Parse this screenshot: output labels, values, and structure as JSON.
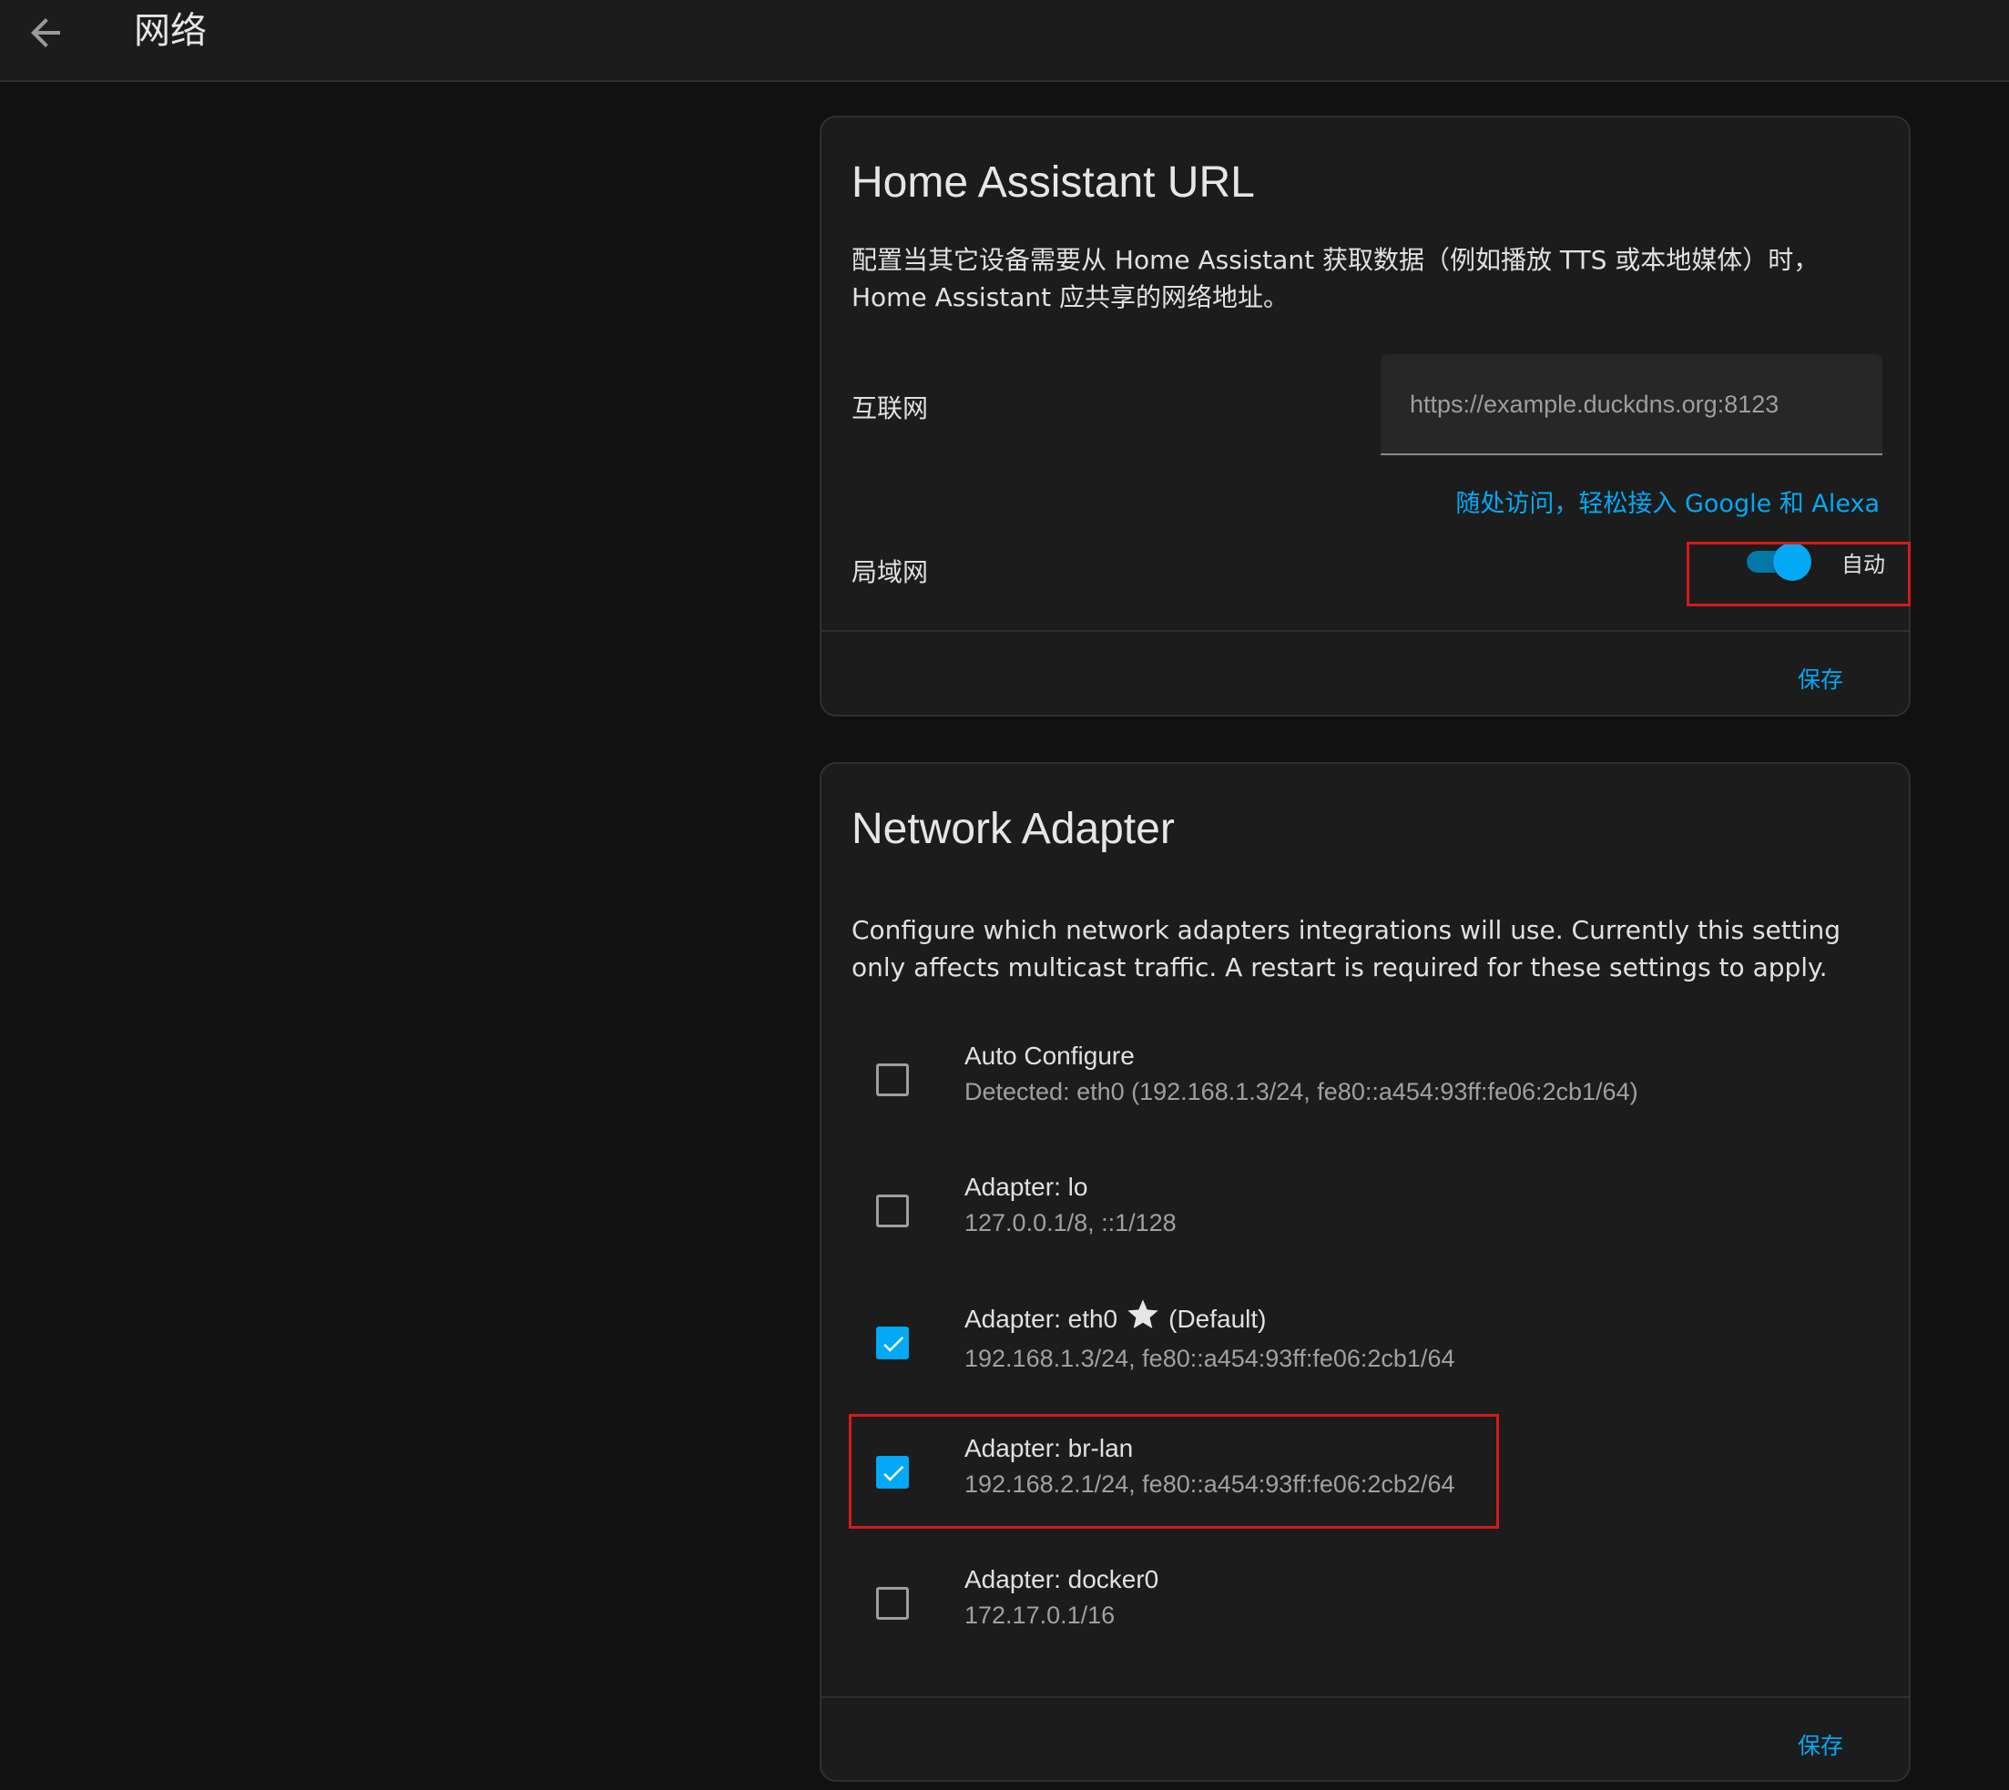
{
  "header": {
    "title": "网络"
  },
  "url_card": {
    "title": "Home Assistant URL",
    "description": "配置当其它设备需要从 Home Assistant 获取数据（例如播放 TTS 或本地媒体）时，Home Assistant 应共享的网络地址。",
    "internet_label": "互联网",
    "internet_value": "",
    "internet_placeholder": "https://example.duckdns.org:8123",
    "promo_link": "随处访问，轻松接入 Google 和 Alexa",
    "lan_label": "局域网",
    "lan_toggle_label": "自动",
    "lan_toggle_on": true,
    "save_label": "保存"
  },
  "adapter_card": {
    "title": "Network Adapter",
    "description": "Configure which network adapters integrations will use. Currently this setting only affects multicast traffic. A restart is required for these settings to apply.",
    "adapters": [
      {
        "name": "Auto Configure",
        "detail": "Detected: eth0 (192.168.1.3/24, fe80::a454:93ff:fe06:2cb1/64)",
        "checked": false
      },
      {
        "name": "Adapter: lo",
        "detail": "127.0.0.1/8, ::1/128",
        "checked": false
      },
      {
        "name": "Adapter: eth0",
        "suffix": "(Default)",
        "detail": "192.168.1.3/24, fe80::a454:93ff:fe06:2cb1/64",
        "checked": true
      },
      {
        "name": "Adapter: br-lan",
        "detail": "192.168.2.1/24, fe80::a454:93ff:fe06:2cb2/64",
        "checked": true
      },
      {
        "name": "Adapter: docker0",
        "detail": "172.17.0.1/16",
        "checked": false
      }
    ],
    "save_label": "保存"
  },
  "colors": {
    "accent": "#03a9f4",
    "highlight": "#d61a1a",
    "background": "#111111",
    "card": "#1c1c1c"
  },
  "icons": {
    "back": "arrow-left-icon",
    "default_adapter": "star-icon",
    "checkbox_checked": "check-icon"
  }
}
